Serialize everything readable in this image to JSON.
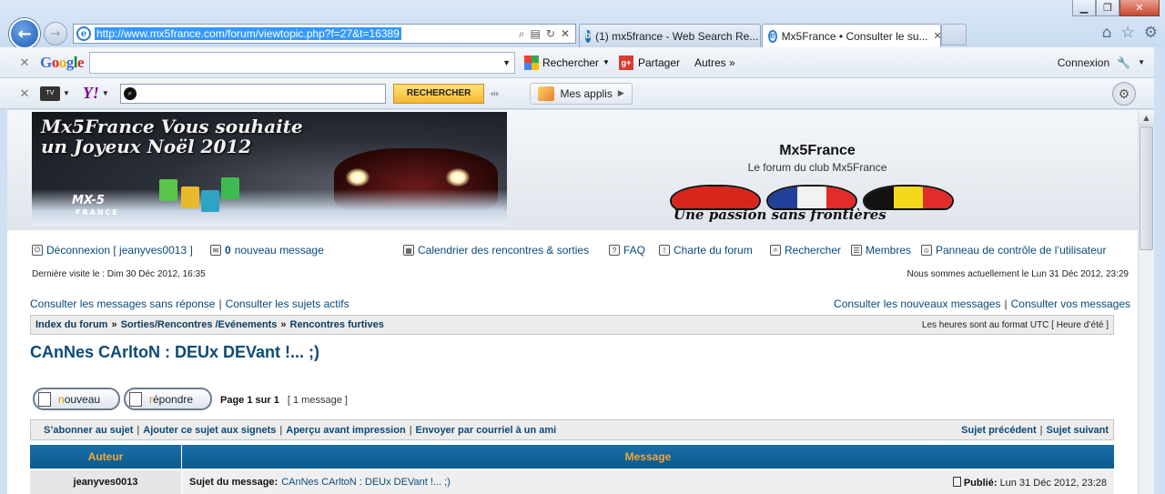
{
  "browser": {
    "address_url": "http://www.mx5france.com/forum/viewtopic.php?f=27&t=16389",
    "tabs": [
      {
        "title": "(1) mx5france - Web Search Re..."
      },
      {
        "title": "Mx5France • Consulter le su..."
      }
    ],
    "google_toolbar": {
      "logo": "Google",
      "search_label": "Rechercher",
      "share_label": "Partager",
      "more_label": "Autres »",
      "connexion_label": "Connexion"
    },
    "yahoo_toolbar": {
      "tv_label": "TV",
      "logo": "Y!",
      "search_button": "RECHERCHER",
      "apps_label": "Mes applis"
    }
  },
  "header": {
    "banner_line1": "Mx5France Vous souhaite",
    "banner_line2": "un Joyeux Noël 2012",
    "banner_brand": "MX-5",
    "banner_brand_sub": "FRANCE",
    "site_title": "Mx5France",
    "site_subtitle": "Le forum du club Mx5France",
    "slogan": "Une passion sans frontières"
  },
  "userbar": {
    "logout": "Déconnexion [ jeanyves0013 ]",
    "new_count": "0",
    "new_msg_label": "nouveau message",
    "calendar": "Calendrier des rencontres & sorties",
    "faq": "FAQ",
    "charter": "Charte du forum",
    "search": "Rechercher",
    "members": "Membres",
    "ucp": "Panneau de contrôle de l’utilisateur"
  },
  "visit": {
    "last_visit": "Dernière visite le : Dim 30 Déc 2012, 16:35",
    "now": "Nous sommes actuellement le Lun 31 Déc 2012, 23:29"
  },
  "quicklinks": {
    "unanswered": "Consulter les messages sans réponse",
    "active": "Consulter les sujets actifs",
    "new_posts": "Consulter les nouveaux messages",
    "your_posts": "Consulter vos messages"
  },
  "breadcrumb": {
    "items": [
      "Index du forum",
      "Sorties/Rencontres /Evénements",
      "Rencontres furtives"
    ],
    "separator": "»",
    "timezone": "Les heures sont au format UTC [ Heure d’été ]"
  },
  "topic": {
    "title": "CAnNes CArltoN : DEUx DEVant !... ;)",
    "new_button_first": "n",
    "new_button_rest": "ouveau",
    "reply_button_first": "r",
    "reply_button_rest": "épondre",
    "page_info": "Page 1 sur 1",
    "message_count": "[ 1 message ]"
  },
  "actions": {
    "subscribe": "S’abonner au sujet",
    "bookmark": "Ajouter ce sujet aux signets",
    "print": "Aperçu avant impression",
    "email": "Envoyer par courriel à un ami",
    "prev": "Sujet précédent",
    "next": "Sujet suivant"
  },
  "table": {
    "col_author": "Auteur",
    "col_message": "Message"
  },
  "post": {
    "author": "jeanyves0013",
    "subject_label": "Sujet du message:",
    "subject": "CAnNes CArltoN : DEUx DEVant !... ;)",
    "published_label": "Publié:",
    "date": "Lun 31 Déc 2012, 23:28"
  },
  "colors": {
    "link": "#0a4a78",
    "header_bar": "#0b5a90",
    "header_text": "#f7a531",
    "selection": "#3399ff"
  }
}
